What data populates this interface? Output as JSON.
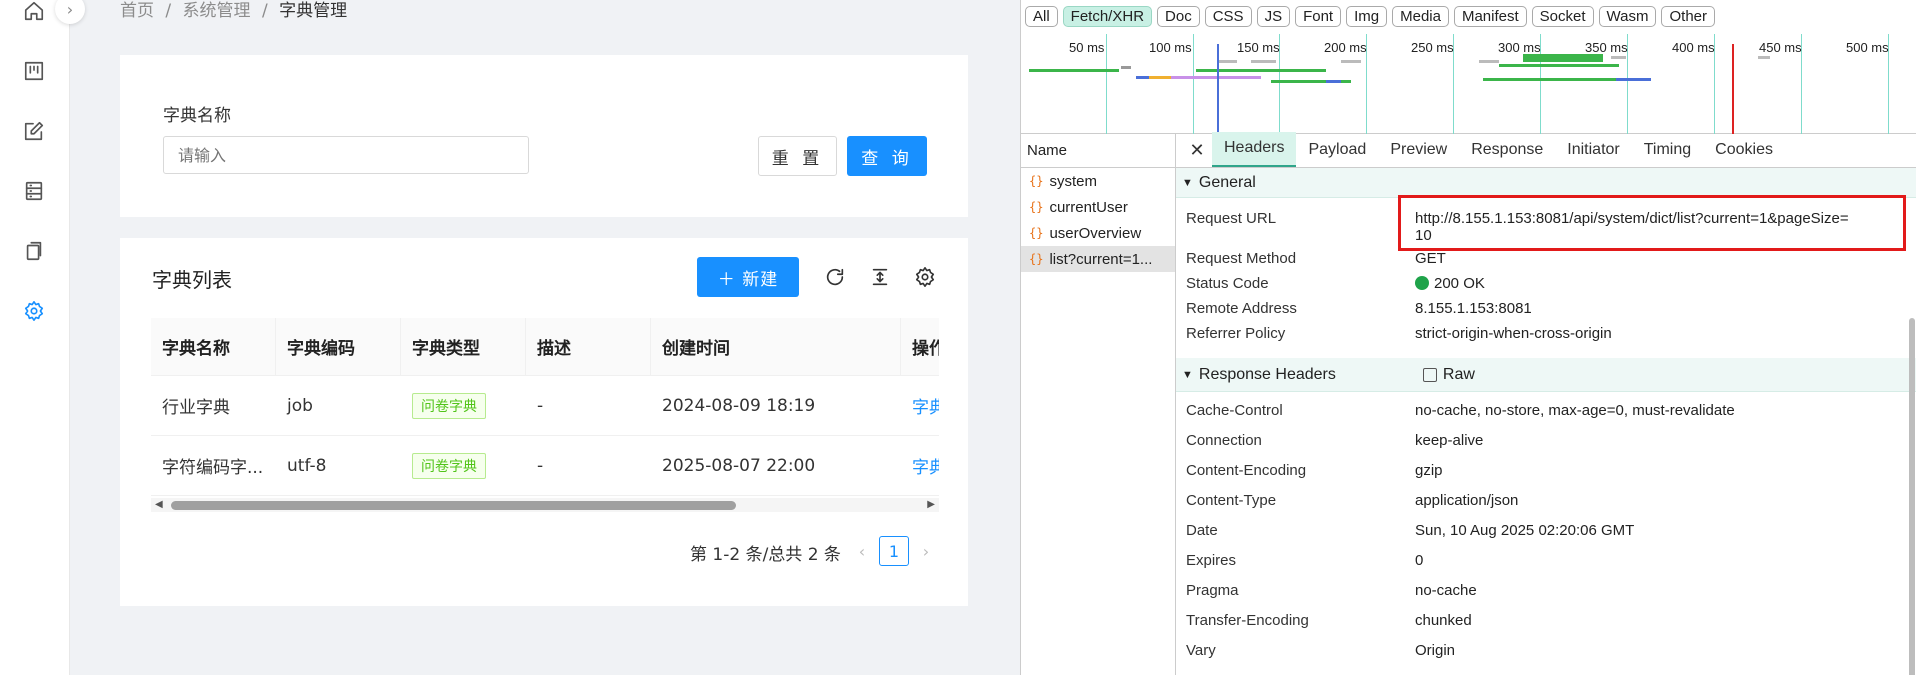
{
  "breadcrumb": {
    "home": "首页",
    "sep": "/",
    "system": "系统管理",
    "current": "字典管理"
  },
  "search": {
    "label": "字典名称",
    "placeholder": "请输入",
    "reset_label": "重 置",
    "query_label": "查 询"
  },
  "list": {
    "title": "字典列表",
    "new_label": "＋ 新建",
    "columns": [
      "字典名称",
      "字典编码",
      "字典类型",
      "描述",
      "创建时间",
      "操作"
    ],
    "rows": [
      {
        "name": "行业字典",
        "code": "job",
        "type": "问卷字典",
        "desc": "-",
        "created": "2024-08-09 18:19",
        "action": "字典"
      },
      {
        "name": "字符编码字...",
        "code": "utf-8",
        "type": "问卷字典",
        "desc": "-",
        "created": "2025-08-07 22:00",
        "action": "字典"
      }
    ]
  },
  "pagination": {
    "summary": "第 1-2 条/总共 2 条",
    "prev": "‹",
    "current": "1",
    "next": "›"
  },
  "devtools": {
    "filters": [
      "All",
      "Fetch/XHR",
      "Doc",
      "CSS",
      "JS",
      "Font",
      "Img",
      "Media",
      "Manifest",
      "Socket",
      "Wasm",
      "Other"
    ],
    "selected_filter": "Fetch/XHR",
    "timeline_ticks": [
      "50 ms",
      "100 ms",
      "150 ms",
      "200 ms",
      "250 ms",
      "300 ms",
      "350 ms",
      "400 ms",
      "450 ms",
      "500 ms"
    ],
    "names_header": "Name",
    "requests": [
      "system",
      "currentUser",
      "userOverview",
      "list?current=1..."
    ],
    "tabs": [
      "Headers",
      "Payload",
      "Preview",
      "Response",
      "Initiator",
      "Timing",
      "Cookies"
    ],
    "selected_tab": "Headers",
    "general_title": "General",
    "general": [
      {
        "key": "Request URL",
        "value": "http://8.155.1.153:8081/api/system/dict/list?current=1&pageSize=",
        "value2": "10"
      },
      {
        "key": "Request Method",
        "value": "GET"
      },
      {
        "key": "Status Code",
        "value": "200 OK"
      },
      {
        "key": "Remote Address",
        "value": "8.155.1.153:8081"
      },
      {
        "key": "Referrer Policy",
        "value": "strict-origin-when-cross-origin"
      }
    ],
    "response_headers_title": "Response Headers",
    "raw_label": "Raw",
    "response_headers": [
      {
        "key": "Cache-Control",
        "value": "no-cache, no-store, max-age=0, must-revalidate"
      },
      {
        "key": "Connection",
        "value": "keep-alive"
      },
      {
        "key": "Content-Encoding",
        "value": "gzip"
      },
      {
        "key": "Content-Type",
        "value": "application/json"
      },
      {
        "key": "Date",
        "value": "Sun, 10 Aug 2025 02:20:06 GMT"
      },
      {
        "key": "Expires",
        "value": "0"
      },
      {
        "key": "Pragma",
        "value": "no-cache"
      },
      {
        "key": "Transfer-Encoding",
        "value": "chunked"
      },
      {
        "key": "Vary",
        "value": "Origin"
      }
    ],
    "colors": {
      "accent": "#1890ff",
      "status_ok": "#1fa34a",
      "highlight": "#e21a1a"
    }
  }
}
